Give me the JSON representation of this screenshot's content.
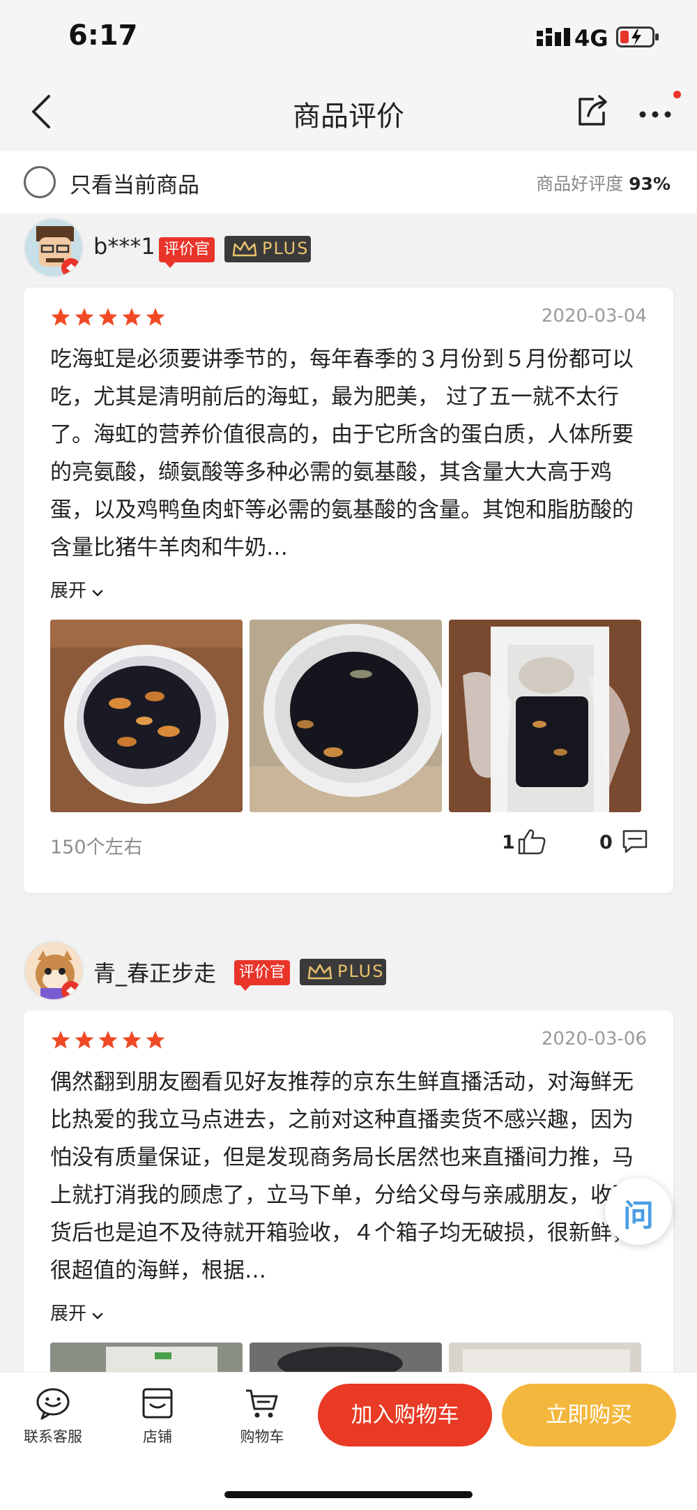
{
  "status": {
    "time": "6:17",
    "network": "4G"
  },
  "nav": {
    "title": "商品评价"
  },
  "filter": {
    "label": "只看当前商品",
    "rating_label": "商品好评度",
    "rating_value": "93%"
  },
  "reviews": [
    {
      "username": "b***1",
      "badge": "评价官",
      "plus": "PLUS",
      "stars": 5,
      "date": "2020-03-04",
      "text": "吃海虹是必须要讲季节的，每年春季的３月份到５月份都可以吃，尤其是清明前后的海虹，最为肥美， 过了五一就不太行了。海虹的营养价值很高的，由于它所含的蛋白质，人体所要的亮氨酸，缬氨酸等多种必需的氨基酸，其含量大大高于鸡蛋，以及鸡鸭鱼肉虾等必需的氨基酸的含量。其饱和脂肪酸的含量比猪牛羊肉和牛奶…",
      "expand": "展开",
      "spec": "150个左右",
      "likes": "1",
      "comments": "0"
    },
    {
      "username": "青_春正步走",
      "badge": "评价官",
      "plus": "PLUS",
      "stars": 5,
      "date": "2020-03-06",
      "text": "偶然翻到朋友圈看见好友推荐的京东生鲜直播活动，对海鲜无比热爱的我立马点进去，之前对这种直播卖货不感兴趣，因为怕没有质量保证，但是发现商务局长居然也来直播间力推，马上就打消我的顾虑了，立马下单，分给父母与亲戚朋友，收到货后也是迫不及待就开箱验收，４个箱子均无破损，很新鲜，很超值的海鲜，根据…",
      "expand": "展开"
    }
  ],
  "float_button": "问",
  "bottom": {
    "service": "联系客服",
    "shop": "店铺",
    "cart": "购物车",
    "add_to_cart": "加入购物车",
    "buy_now": "立即购买"
  },
  "colors": {
    "accent_red": "#e83a24",
    "accent_orange": "#f4b73d",
    "star": "#f04a24"
  }
}
